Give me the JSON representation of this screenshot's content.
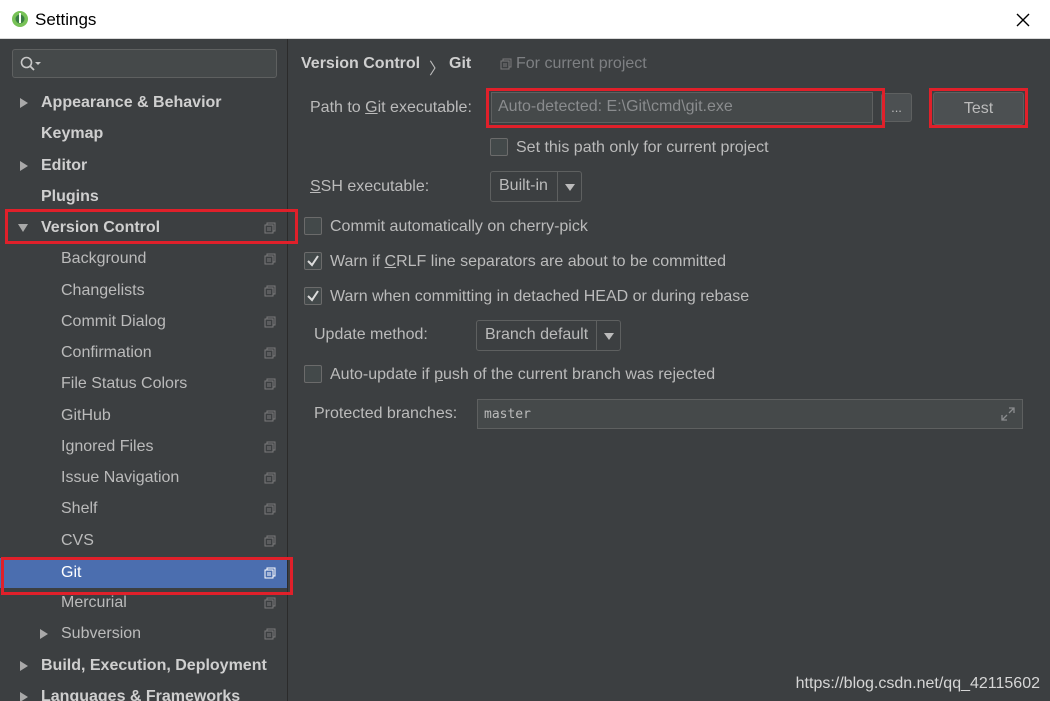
{
  "window": {
    "title": "Settings"
  },
  "sidebar": {
    "search_placeholder": "",
    "items": [
      {
        "label": "Appearance & Behavior"
      },
      {
        "label": "Keymap"
      },
      {
        "label": "Editor"
      },
      {
        "label": "Plugins"
      },
      {
        "label": "Version Control"
      },
      {
        "label": "Background"
      },
      {
        "label": "Changelists"
      },
      {
        "label": "Commit Dialog"
      },
      {
        "label": "Confirmation"
      },
      {
        "label": "File Status Colors"
      },
      {
        "label": "GitHub"
      },
      {
        "label": "Ignored Files"
      },
      {
        "label": "Issue Navigation"
      },
      {
        "label": "Shelf"
      },
      {
        "label": "CVS"
      },
      {
        "label": "Git"
      },
      {
        "label": "Mercurial"
      },
      {
        "label": "Subversion"
      },
      {
        "label": "Build, Execution, Deployment"
      },
      {
        "label": "Languages & Frameworks"
      }
    ]
  },
  "breadcrumb": {
    "parent": "Version Control",
    "separator": "〉",
    "current": "Git",
    "scope": "For current project"
  },
  "git": {
    "path_label_pre": "Path to ",
    "path_label_u": "G",
    "path_label_post": "it executable:",
    "path_value": "Auto-detected: E:\\Git\\cmd\\git.exe",
    "browse_label": "...",
    "test_label": "Test",
    "set_path_label": "Set this path only for current project",
    "ssh_label_u": "S",
    "ssh_label_post": "SH executable:",
    "ssh_value": "Built-in",
    "cherry_pick_label": "Commit automatically on cherry-pick",
    "crlf_pre": "Warn if ",
    "crlf_u": "C",
    "crlf_post": "RLF line separators are about to be committed",
    "detached_label": "Warn when committing in detached HEAD or during rebase",
    "update_method_label": "Update method:",
    "update_method_value": "Branch default",
    "auto_update_pre": "Auto-update if ",
    "auto_update_u": "p",
    "auto_update_post": "ush of the current branch was rejected",
    "protected_label": "Protected branches:",
    "protected_value": "master"
  },
  "checkboxes": {
    "set_path": false,
    "cherry_pick": false,
    "crlf": true,
    "detached": true,
    "auto_update": false
  },
  "watermark": "https://blog.csdn.net/qq_42115602",
  "colors": {
    "selection": "#4b6eaf",
    "annotation_red": "#e0202a",
    "panel_bg": "#3c3f41"
  }
}
